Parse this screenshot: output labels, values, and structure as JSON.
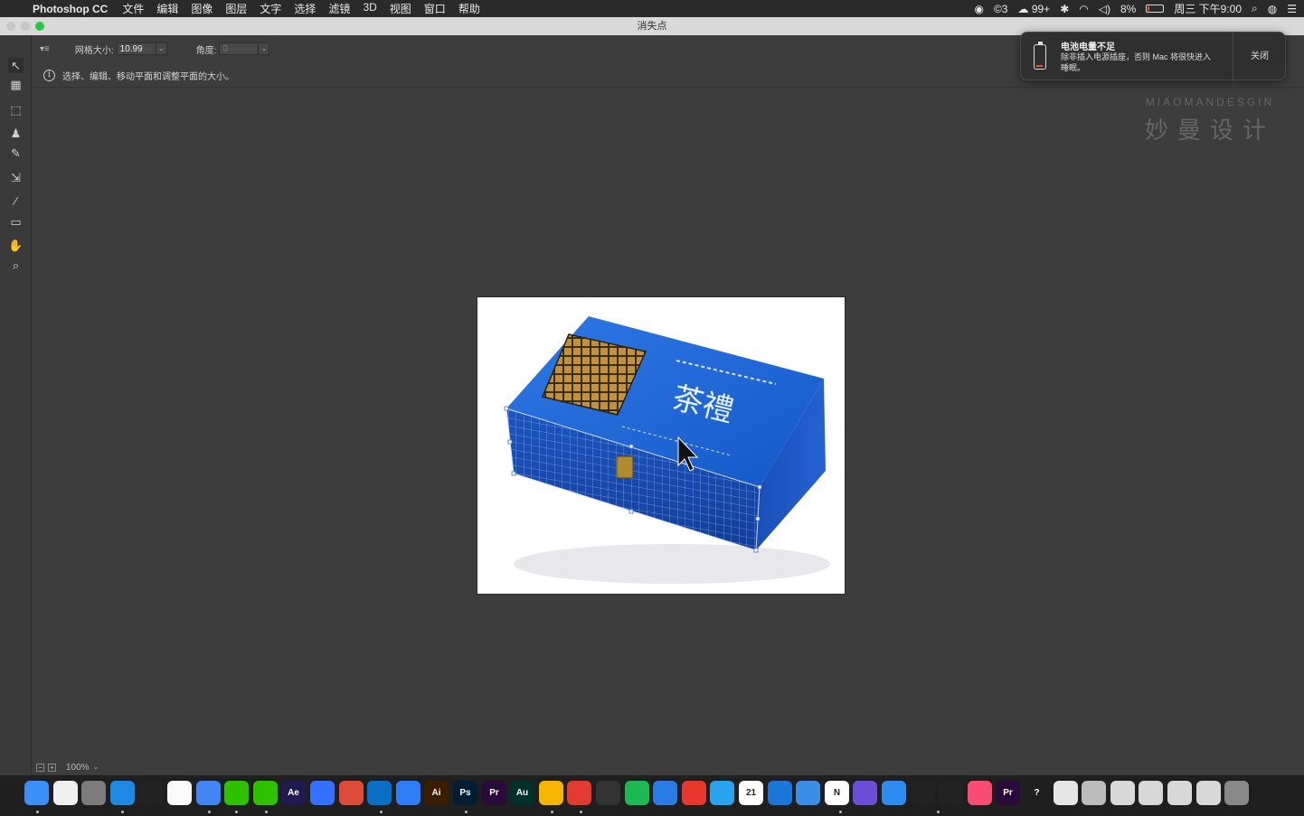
{
  "menubar": {
    "apple": "",
    "app_name": "Photoshop CC",
    "items": [
      "文件",
      "编辑",
      "图像",
      "图层",
      "文字",
      "选择",
      "滤镜",
      "3D",
      "视图",
      "窗口",
      "帮助"
    ],
    "status": {
      "badge_c": "3",
      "wechat_count": "99+",
      "battery": "8%",
      "datetime": "周三 下午9:00"
    }
  },
  "window": {
    "title": "消失点",
    "traffic_colors": [
      "#c6c6c6",
      "#c6c6c6",
      "#27c93f"
    ]
  },
  "options": {
    "grid_label": "网格大小:",
    "grid_value": "10.99",
    "angle_label": "角度:",
    "angle_value": "0"
  },
  "info": {
    "text": "选择、编辑、移动平面和调整平面的大小。"
  },
  "tools": [
    {
      "name": "edit-plane-tool",
      "glyph": "↖",
      "active": true
    },
    {
      "name": "create-plane-tool",
      "glyph": "▦"
    },
    {
      "name": "marquee-tool",
      "glyph": "⬚"
    },
    {
      "name": "stamp-tool",
      "glyph": "♟"
    },
    {
      "name": "brush-tool",
      "glyph": "✎"
    },
    {
      "name": "transform-tool",
      "glyph": "⇲"
    },
    {
      "name": "eyedropper-tool",
      "glyph": "⁄"
    },
    {
      "name": "measure-tool",
      "glyph": "▭"
    },
    {
      "name": "hand-tool",
      "glyph": "✋"
    },
    {
      "name": "zoom-tool",
      "glyph": "⌕"
    }
  ],
  "status": {
    "zoom": "100%"
  },
  "notification": {
    "title": "电池电量不足",
    "body": "除非插入电源插座，否则 Mac 将很快进入睡眠。",
    "close": "关闭"
  },
  "watermark": {
    "en": "MIAOMANDESGIN",
    "cn": "妙曼设计"
  },
  "image": {
    "box_text": "茶禮"
  },
  "dock": [
    {
      "name": "finder-icon",
      "label": "",
      "color": "#3b8ff5"
    },
    {
      "name": "notes-icon",
      "label": "",
      "color": "#f0f0f0"
    },
    {
      "name": "system-prefs-icon",
      "label": "",
      "color": "#7c7c7c"
    },
    {
      "name": "browser-icon",
      "label": "",
      "color": "#1e88e5"
    },
    {
      "name": "qq-icon",
      "label": "",
      "color": "#222"
    },
    {
      "name": "stickies-icon",
      "label": "",
      "color": "#fafafa"
    },
    {
      "name": "chrome-alt-icon",
      "label": "",
      "color": "#4285f4"
    },
    {
      "name": "wechat-icon",
      "label": "",
      "color": "#2dc100"
    },
    {
      "name": "wechat-work-icon",
      "label": "",
      "color": "#2dc100"
    },
    {
      "name": "after-effects-icon",
      "label": "Ae",
      "color": "#1f1a4f"
    },
    {
      "name": "feishu-icon",
      "label": "",
      "color": "#3370ff"
    },
    {
      "name": "chrome-icon",
      "label": "",
      "color": "#dd4b39"
    },
    {
      "name": "edge-icon",
      "label": "",
      "color": "#0c6fc6"
    },
    {
      "name": "baidu-netdisk-icon",
      "label": "",
      "color": "#2f7df6"
    },
    {
      "name": "illustrator-icon",
      "label": "Ai",
      "color": "#3b1d00"
    },
    {
      "name": "photoshop-icon",
      "label": "Ps",
      "color": "#001d34"
    },
    {
      "name": "premiere-icon",
      "label": "Pr",
      "color": "#2a0a3a"
    },
    {
      "name": "audition-icon",
      "label": "Au",
      "color": "#00302a"
    },
    {
      "name": "sketch-icon",
      "label": "",
      "color": "#f7b500"
    },
    {
      "name": "netease-music-icon",
      "label": "",
      "color": "#e13c2f"
    },
    {
      "name": "pen-icon",
      "label": "",
      "color": "#333"
    },
    {
      "name": "spotify-icon",
      "label": "",
      "color": "#1db954"
    },
    {
      "name": "keynote-icon",
      "label": "",
      "color": "#2a7be4"
    },
    {
      "name": "xmind-icon",
      "label": "",
      "color": "#e8372c"
    },
    {
      "name": "safari-compass-icon",
      "label": "",
      "color": "#2aa3ef"
    },
    {
      "name": "calendar-icon",
      "label": "21",
      "color": "#ffffff"
    },
    {
      "name": "safari-icon",
      "label": "",
      "color": "#1b76d8"
    },
    {
      "name": "vpn-icon",
      "label": "",
      "color": "#3a8ee6"
    },
    {
      "name": "notion-icon",
      "label": "N",
      "color": "#ffffff"
    },
    {
      "name": "purple-app-icon",
      "label": "",
      "color": "#6a4fd6"
    },
    {
      "name": "send-icon",
      "label": "",
      "color": "#2d8cf0"
    },
    {
      "name": "magic-icon",
      "label": "",
      "color": "#222"
    },
    {
      "name": "stats-icon",
      "label": "",
      "color": "#222"
    },
    {
      "name": "itunes-icon",
      "label": "",
      "color": "#f94c73"
    },
    {
      "name": "premiere-rush-icon",
      "label": "Pr",
      "color": "#2a0a3a"
    },
    {
      "name": "help-icon",
      "label": "?",
      "color": "#1f1f1f"
    },
    {
      "name": "preview-icon",
      "label": "",
      "color": "#e6e6e6"
    },
    {
      "name": "document-icon",
      "label": "",
      "color": "#bbb"
    },
    {
      "name": "folder-1-icon",
      "label": "",
      "color": "#d8d8d8"
    },
    {
      "name": "folder-2-icon",
      "label": "",
      "color": "#d8d8d8"
    },
    {
      "name": "folder-3-icon",
      "label": "",
      "color": "#d8d8d8"
    },
    {
      "name": "folder-4-icon",
      "label": "",
      "color": "#d8d8d8"
    },
    {
      "name": "trash-icon",
      "label": "",
      "color": "#888"
    }
  ]
}
